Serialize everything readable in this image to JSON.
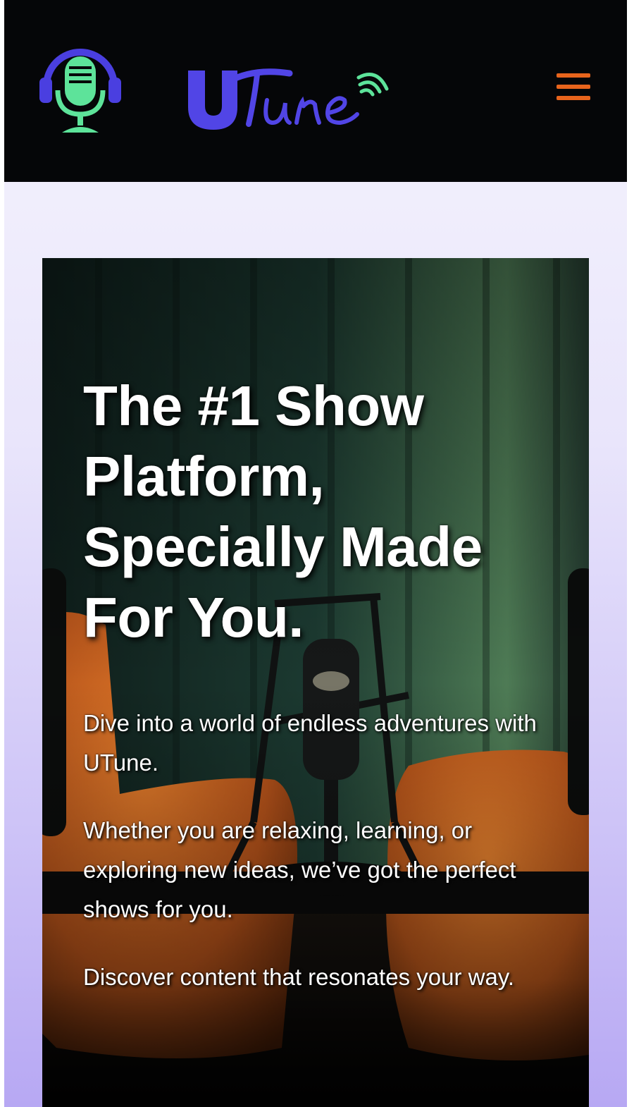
{
  "header": {
    "logo_icon": "podcast-mic-headphones-icon",
    "brand_name": "UTune",
    "menu_icon": "hamburger-menu-icon",
    "colors": {
      "background": "#050608",
      "mic": "#5de39a",
      "brand": "#5145e6",
      "menu": "#e8641c"
    }
  },
  "hero": {
    "title": "The #1 Show Platform, Specially Made For You.",
    "paragraphs": [
      "Dive into a world of endless adventures with UTune.",
      "Whether you are relaxing, learning, or exploring new ideas, we’ve got the perfect shows for you.",
      "Discover content that resonates your way."
    ]
  }
}
